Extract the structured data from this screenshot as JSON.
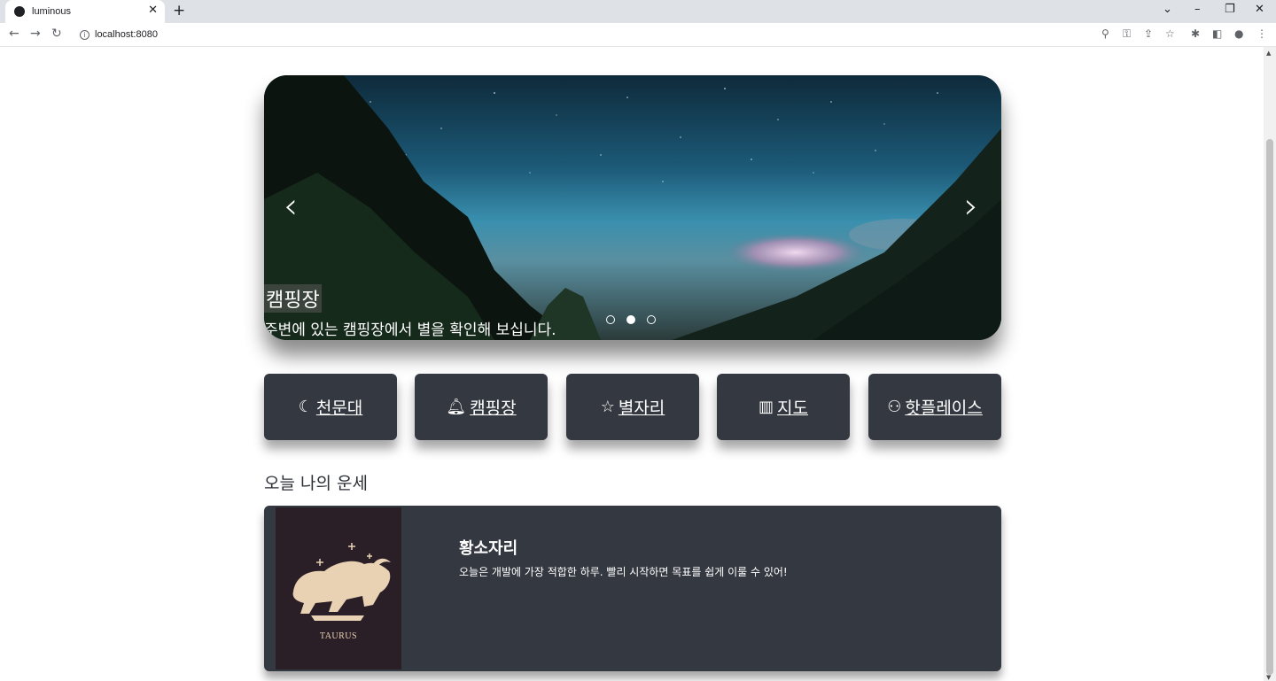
{
  "browser": {
    "tab_title": "luminous",
    "url": "localhost:8080"
  },
  "carousel": {
    "title": "캠핑장",
    "description": "주변에 있는 캠핑장에서 별을 확인해 보십니다.",
    "slide_count": 3,
    "active_slide": 2
  },
  "nav": {
    "items": [
      {
        "icon": "moon-icon",
        "label": "천문대"
      },
      {
        "icon": "bell-icon",
        "label": "캠핑장"
      },
      {
        "icon": "star-icon",
        "label": "별자리"
      },
      {
        "icon": "map-icon",
        "label": "지도"
      },
      {
        "icon": "people-icon",
        "label": "핫플레이스"
      }
    ]
  },
  "fortune": {
    "section_title": "오늘 나의 운세",
    "sign_name": "황소자리",
    "message": "오늘은 개발에 가장 적합한 하루. 빨리 시작하면 목표를 쉽게 이룰 수 있어!",
    "image_caption": "TAURUS"
  }
}
